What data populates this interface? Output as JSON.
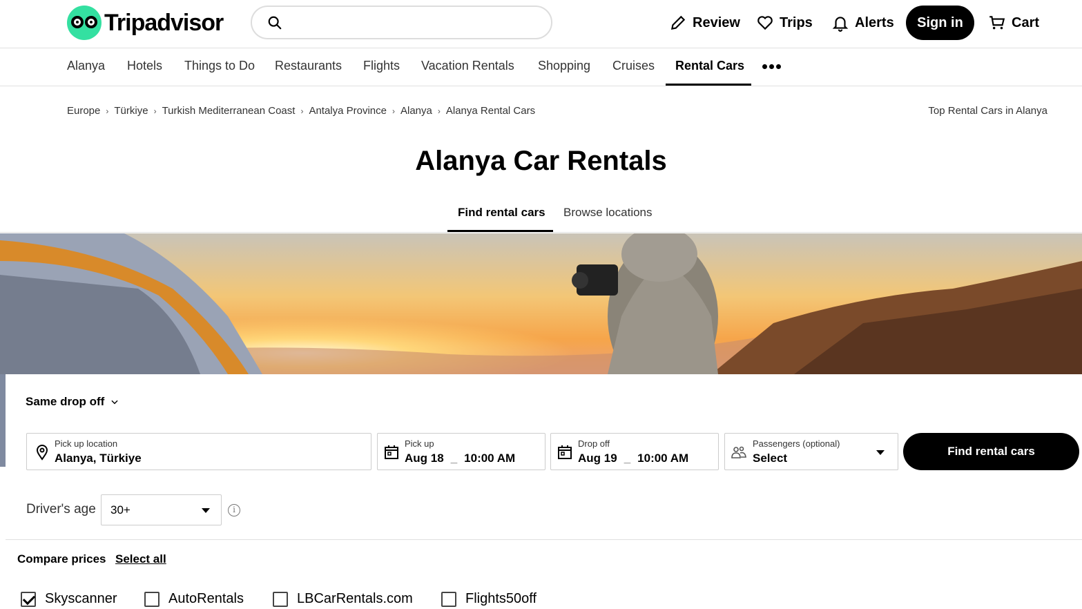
{
  "brand": {
    "name": "Tripadvisor",
    "accent": "#34e0a1"
  },
  "header": {
    "search_placeholder": "",
    "review": "Review",
    "trips": "Trips",
    "alerts": "Alerts",
    "signin": "Sign in",
    "cart": "Cart"
  },
  "subnav": {
    "items": [
      "Alanya",
      "Hotels",
      "Things to Do",
      "Restaurants",
      "Flights",
      "Vacation Rentals",
      "Shopping",
      "Cruises",
      "Rental Cars"
    ],
    "active": "Rental Cars"
  },
  "breadcrumb": [
    "Europe",
    "Türkiye",
    "Turkish Mediterranean Coast",
    "Antalya Province",
    "Alanya",
    "Alanya Rental Cars"
  ],
  "top_rental": "Top Rental Cars in Alanya",
  "page_title": "Alanya Car Rentals",
  "tabs": {
    "find": "Find rental cars",
    "browse": "Browse locations"
  },
  "form": {
    "dropoff_toggle": "Same drop off",
    "pickup_location": {
      "label": "Pick up location",
      "value": "Alanya, Türkiye"
    },
    "pickup": {
      "label": "Pick up",
      "date": "Aug 18",
      "time": "10:00 AM"
    },
    "dropoff": {
      "label": "Drop off",
      "date": "Aug 19",
      "time": "10:00 AM"
    },
    "passengers": {
      "label": "Passengers (optional)",
      "value": "Select"
    },
    "submit": "Find rental cars",
    "drivers_age_label": "Driver's age",
    "drivers_age_value": "30+"
  },
  "compare": {
    "label": "Compare prices",
    "select_all": "Select all",
    "providers": [
      {
        "name": "Skyscanner",
        "checked": true
      },
      {
        "name": "AutoRentals",
        "checked": false
      },
      {
        "name": "LBCarRentals.com",
        "checked": false
      },
      {
        "name": "Flights50off",
        "checked": false
      }
    ]
  }
}
